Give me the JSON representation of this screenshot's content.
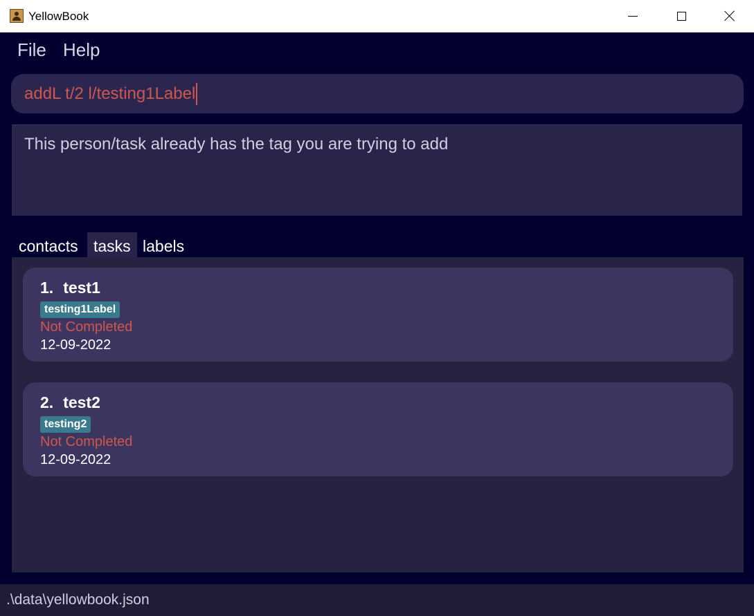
{
  "window": {
    "title": "YellowBook",
    "app_icon": "contact-book-icon"
  },
  "menu": {
    "file": "File",
    "help": "Help"
  },
  "command": {
    "value": "addL t/2 l/testing1Label",
    "text_color": "#d0564e"
  },
  "result": {
    "message": "This person/task already has the tag you are trying to add"
  },
  "tabs": [
    {
      "label": "contacts",
      "selected": false
    },
    {
      "label": "tasks",
      "selected": true
    },
    {
      "label": "labels",
      "selected": false
    }
  ],
  "tasks": [
    {
      "index": "1.",
      "name": "test1",
      "label": "testing1Label",
      "status": "Not Completed",
      "date": "12-09-2022"
    },
    {
      "index": "2.",
      "name": "test2",
      "label": "testing2",
      "status": "Not Completed",
      "date": "12-09-2022"
    }
  ],
  "statusbar": {
    "path": ".\\data\\yellowbook.json"
  },
  "colors": {
    "background": "#02002e",
    "card": "#3c3560",
    "tag": "#3b7a8c",
    "status_incomplete": "#d0564e"
  }
}
